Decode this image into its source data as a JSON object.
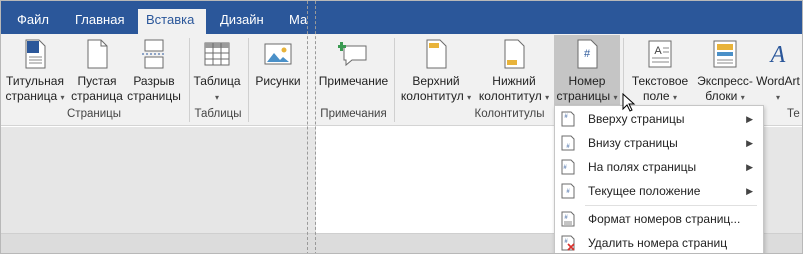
{
  "tabs": [
    {
      "label": "Файл"
    },
    {
      "label": "Главная"
    },
    {
      "label": "Вставка"
    },
    {
      "label": "Дизайн"
    },
    {
      "label": "Ма"
    }
  ],
  "ribbon": {
    "title_page": {
      "line1": "Титульная",
      "line2": "страница"
    },
    "blank_page": {
      "line1": "Пустая",
      "line2": "страница"
    },
    "page_break": {
      "line1": "Разрыв",
      "line2": "страницы"
    },
    "table": {
      "line1": "Таблица"
    },
    "pictures": {
      "line1": "Рисунки"
    },
    "comment": {
      "line1": "Примечание"
    },
    "header": {
      "line1": "Верхний",
      "line2": "колонтитул"
    },
    "footer": {
      "line1": "Нижний",
      "line2": "колонтитул"
    },
    "page_number": {
      "line1": "Номер",
      "line2": "страницы"
    },
    "text_box": {
      "line1": "Текстовое",
      "line2": "поле"
    },
    "quick_parts": {
      "line1": "Экспресс-",
      "line2": "блоки"
    },
    "wordart": {
      "line1": "WordArt"
    },
    "groups": {
      "pages": "Страницы",
      "tables": "Таблицы",
      "comments": "Примечания",
      "header_footer": "Колонтитулы",
      "text_partial": "Те"
    }
  },
  "menu": {
    "items": [
      {
        "label": "Вверху страницы",
        "icon": "page-top-icon"
      },
      {
        "label": "Внизу страницы",
        "icon": "page-bottom-icon"
      },
      {
        "label": "На полях страницы",
        "icon": "page-margin-icon"
      },
      {
        "label": "Текущее положение",
        "icon": "current-position-icon"
      },
      {
        "label": "Формат номеров страниц...",
        "icon": "format-page-numbers-icon"
      },
      {
        "label": "Удалить номера страниц",
        "icon": "remove-page-numbers-icon"
      }
    ]
  },
  "colors": {
    "tab_bar": "#2b579a",
    "ribbon_bg": "#f1f1f1",
    "highlight": "#c5c5c5",
    "accent_icon": "#2b579a",
    "delete_red": "#d9302c",
    "comment_plus_green": "#3a9a52"
  }
}
